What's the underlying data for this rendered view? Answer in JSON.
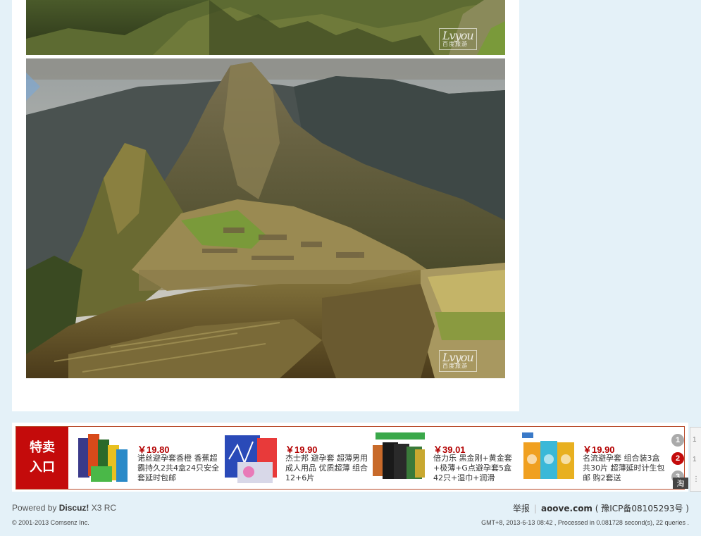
{
  "post": {
    "photo_1_alt": "mountain-ruins-photo-top",
    "photo_2_alt": "machu-picchu-photo",
    "watermark_main": "Lvyou",
    "watermark_sub": "百度旅游"
  },
  "ad": {
    "badge_line1": "特卖",
    "badge_line2": "入口",
    "products": [
      {
        "price": "￥19.80",
        "desc": "诺丝避孕套香橙 香蕉超霸持久2共4盒24只安全套延时包邮"
      },
      {
        "price": "￥19.90",
        "desc": "杰士邦 避孕套 超薄男用成人用品 优质超薄 组合 12+6片"
      },
      {
        "price": "￥39.01",
        "desc": "倍力乐 黑金刚+黄金套+极薄+G点避孕套5盒42只+湿巾+润滑"
      },
      {
        "price": "￥19.90",
        "desc": "名流避孕套 组合装3盒共30片 超薄延时计生包邮 购2套送"
      }
    ],
    "pager": [
      "1",
      "2",
      "3"
    ],
    "tao_label": "淘",
    "colors": {
      "badge": "#c40b0b",
      "price": "#b30000",
      "frame": "#b84a2a"
    }
  },
  "edge_widget": {
    "glyphs": [
      "1",
      "1",
      "⋮"
    ]
  },
  "footer": {
    "powered_by": "Powered by",
    "brand": "Discuz!",
    "version": "X3 RC",
    "copyright": "© 2001-2013 Comsenz Inc.",
    "report": "举报",
    "site": "aoove.com",
    "icp": "( 豫ICP备08105293号 )",
    "processed": "GMT+8, 2013-6-13 08:42 , Processed in 0.081728 second(s), 22 queries ."
  }
}
